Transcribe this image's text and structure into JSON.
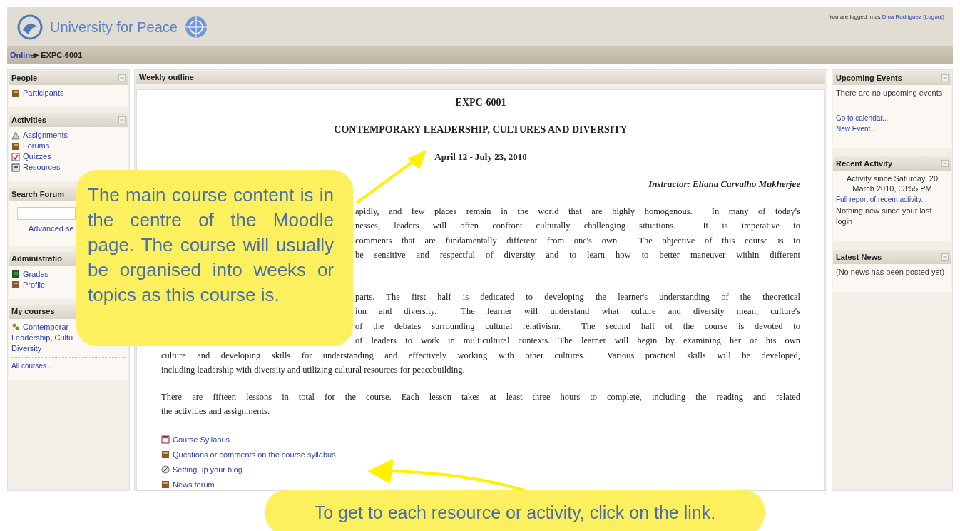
{
  "header": {
    "logo_text": "University for Peace",
    "login": {
      "prefix": "You are logged in as",
      "user": "Dina Rodriguez",
      "logout": "(Logout)"
    }
  },
  "breadcrumb": [
    {
      "label": "Online",
      "kind": "link"
    },
    {
      "label": "▶",
      "kind": "separator"
    },
    {
      "label": "EXPC-6001",
      "kind": "current"
    }
  ],
  "left_blocks": [
    {
      "title": "People",
      "kind": "links",
      "items": [
        {
          "label": "Participants",
          "kind": "people"
        }
      ]
    },
    {
      "title": "Activities",
      "kind": "links",
      "items": [
        {
          "label": "Assignments",
          "kind": "assignment"
        },
        {
          "label": "Forums",
          "kind": "people"
        },
        {
          "label": "Quizzes",
          "kind": "quiz"
        },
        {
          "label": "Resources",
          "kind": "resource"
        }
      ]
    },
    {
      "title": "Search Forum",
      "kind": "search",
      "link": "Advanced se"
    },
    {
      "title": "Administratio",
      "kind": "links",
      "items": [
        {
          "label": "Grades",
          "kind": "grades"
        },
        {
          "label": "Profile",
          "kind": "people"
        }
      ]
    },
    {
      "title": "My courses",
      "kind": "courses",
      "course_lines": [
        "Contemporar",
        "Leadership, Cultu",
        "Diversity"
      ],
      "link": "All courses ..."
    }
  ],
  "center": {
    "section_title": "Weekly outline",
    "course_code": "EXPC-6001",
    "course_title": "CONTEMPORARY LEADERSHIP, CULTURES AND DIVERSITY",
    "dates": "April 12 - July 23, 2010",
    "instructor": "Instructor: Eliana Carvalho Mukherjee",
    "paragraphs": [
      {
        "lines": [
          {
            "kind": "partial",
            "text": "apidly, and few places remain in the world that are highly homogenous.  In many of today's"
          },
          {
            "kind": "partial",
            "text": "nesses, leaders will often confront culturally challenging situations.  It is imperative to"
          },
          {
            "kind": "partial",
            "text": "comments that are fundamentally different from one's own.  The objective of this course is to"
          },
          {
            "kind": "partial",
            "text": "be sensitive and respectful of diversity and to learn how to better maneuver within different"
          }
        ]
      },
      {
        "lines": [
          {
            "kind": "partial",
            "text": "parts. The first half is dedicated to developing the learner's understanding of the theoretical"
          },
          {
            "kind": "partial",
            "text": "ion and diversity.  The learner will understand what culture and diversity mean, culture's"
          },
          {
            "kind": "partial",
            "text": "of the debates surrounding cultural relativism.  The second half of the course is devoted to"
          },
          {
            "kind": "partial",
            "text": "of leaders to work in multicultural contexts. The learner will begin by examining her or his own"
          },
          {
            "kind": "full",
            "text": "culture and developing skills for understanding and effectively working with other cultures.  Various practical skills will be developed,"
          },
          {
            "kind": "last",
            "text": "including leadership with diversity and utilizing cultural resources for peacebuilding."
          }
        ]
      },
      {
        "lines": [
          {
            "kind": "full",
            "text": "There are fifteen lessons in total for the course. Each lesson takes at least three hours to complete, including the reading and related"
          },
          {
            "kind": "last",
            "text": "the activities and assignments."
          }
        ]
      }
    ],
    "resources": [
      {
        "label": "Course Syllabus",
        "kind": "syllabus"
      },
      {
        "label": "Questions or comments on the course syllabus",
        "kind": "forum"
      },
      {
        "label": "Setting up your blog",
        "kind": "blog"
      },
      {
        "label": "News forum",
        "kind": "forum"
      }
    ]
  },
  "right_blocks": [
    {
      "title": "Upcoming Events",
      "items": [
        {
          "kind": "text",
          "label": "There are no upcoming events"
        },
        {
          "kind": "rule"
        },
        {
          "kind": "link",
          "label": "Go to calendar..."
        },
        {
          "kind": "link",
          "label": "New Event..."
        }
      ]
    },
    {
      "title": "Recent Activity",
      "items": [
        {
          "kind": "note",
          "label": "Activity since Saturday, 20 March 2010, 03:55 PM"
        },
        {
          "kind": "link",
          "label": "Full report of recent activity..."
        },
        {
          "kind": "text",
          "label": "Nothing new since your last login"
        }
      ]
    },
    {
      "title": "Latest News",
      "items": [
        {
          "kind": "text",
          "label": "(No news has been posted yet)"
        }
      ]
    }
  ],
  "callouts": [
    {
      "text": "The main course content is in the centre of the Moodle page. The course will usually be organised into weeks or topics as this course is."
    },
    {
      "text": "To get to each resource or activity, click on the link."
    }
  ]
}
